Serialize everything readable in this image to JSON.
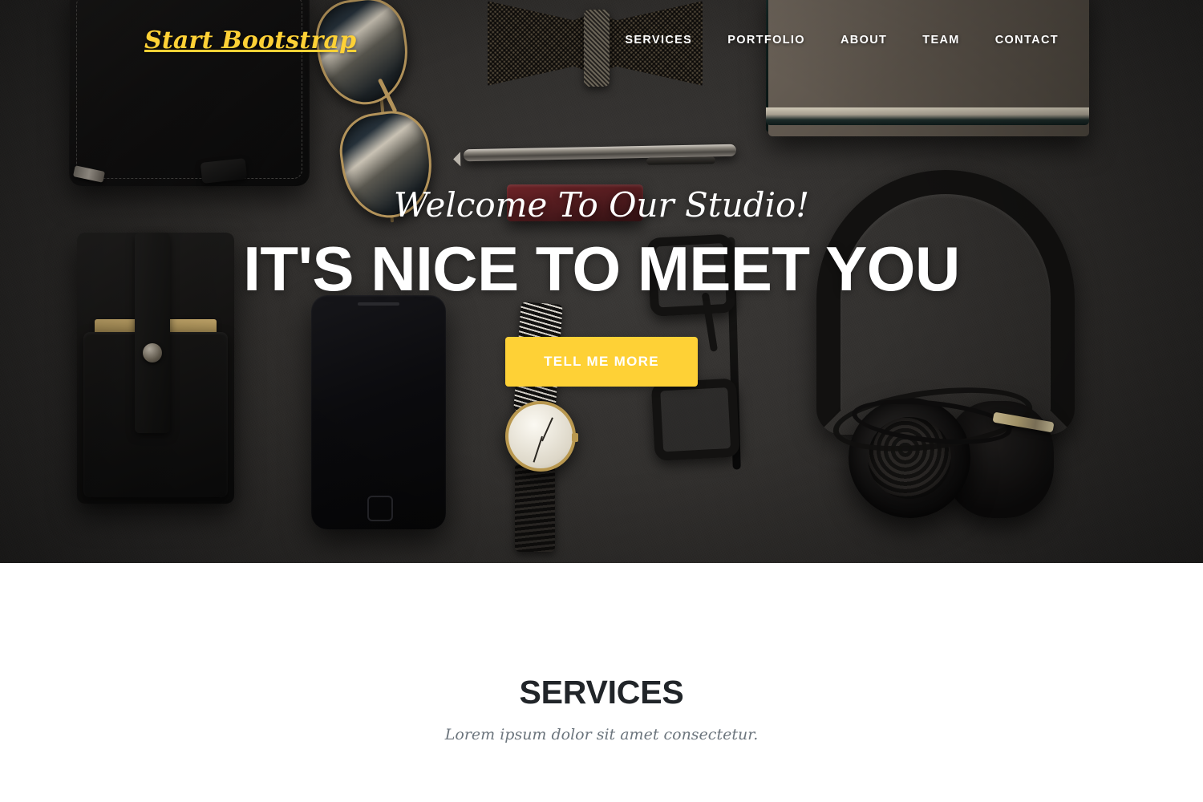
{
  "navbar": {
    "brand": "Start Bootstrap",
    "links": [
      {
        "label": "Services"
      },
      {
        "label": "Portfolio"
      },
      {
        "label": "About"
      },
      {
        "label": "Team"
      },
      {
        "label": "Contact"
      }
    ]
  },
  "hero": {
    "lead": "Welcome To Our Studio!",
    "heading": "It's Nice To Meet You",
    "cta_label": "Tell Me More",
    "accent_color": "#fed136",
    "text_color": "#ffffff",
    "background": "dark flat-lay desk photo"
  },
  "services": {
    "heading": "Services",
    "subheading": "Lorem ipsum dolor sit amet consectetur.",
    "heading_color": "#212529",
    "subheading_color": "#6c757d",
    "background_color": "#ffffff"
  },
  "icons": {
    "wallet": "wallet-icon",
    "sunglasses": "sunglasses-icon",
    "bow_tie": "bow-tie-icon",
    "pen": "pen-icon",
    "notebook": "notebook-icon",
    "card_holder": "card-holder-icon",
    "phone": "phone-icon",
    "watch": "watch-icon",
    "eyeglasses": "eyeglasses-icon",
    "headphones": "headphones-icon",
    "case": "case-icon"
  }
}
